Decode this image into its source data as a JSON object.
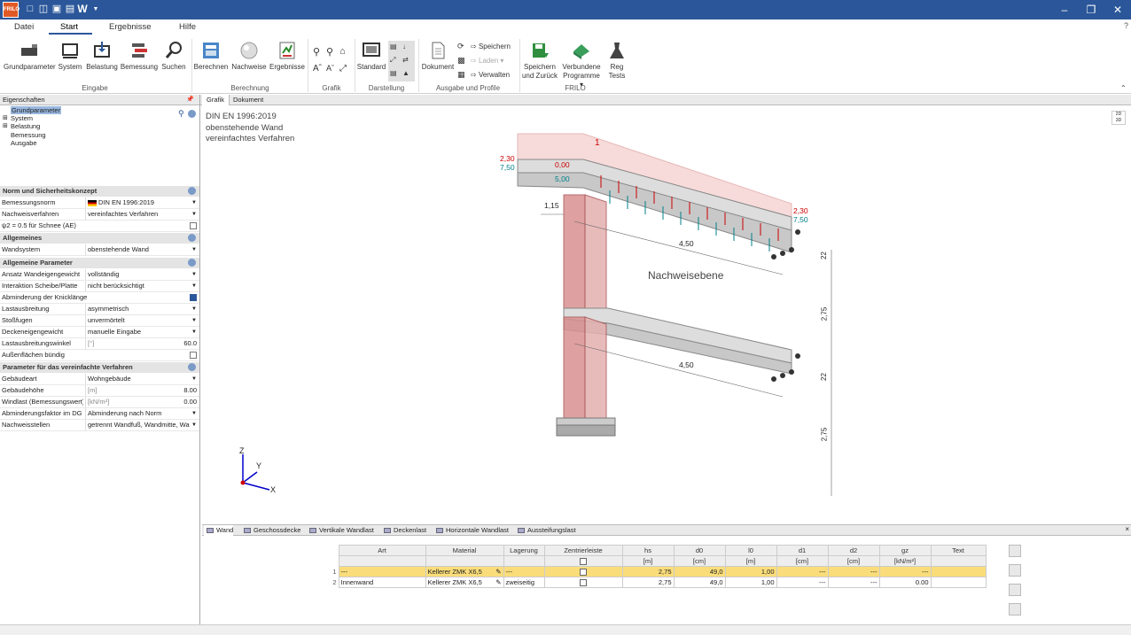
{
  "titlebar": {
    "logo": "FRILO",
    "app_letter": "W"
  },
  "menu": {
    "tabs": [
      "Datei",
      "Start",
      "Ergebnisse",
      "Hilfe"
    ],
    "active": "Start"
  },
  "ribbon": {
    "eingabe": [
      "Grundparameter",
      "System",
      "Belastung",
      "Bemessung",
      "Suchen"
    ],
    "eingabe_label": "Eingabe",
    "berechnung": [
      "Berechnen",
      "Nachweise",
      "Ergebnisse"
    ],
    "berechnung_label": "Berechnung",
    "grafik_label": "Grafik",
    "darstellung": {
      "button": "Standard",
      "label": "Darstellung"
    },
    "ausgabe": {
      "dokument": "Dokument",
      "speichern": "Speichern",
      "laden": "Laden",
      "verwalten": "Verwalten",
      "label": "Ausgabe und Profile"
    },
    "frilo": {
      "speichern_l1": "Speichern",
      "speichern_l2": "und Zurück",
      "verbundene_l1": "Verbundene",
      "verbundene_l2": "Programme",
      "reg_l1": "Reg",
      "reg_l2": "Tests",
      "label": "FRILO"
    }
  },
  "left": {
    "header": "Eigenschaften",
    "tree": [
      "Grundparameter",
      "System",
      "Belastung",
      "Bemessung",
      "Ausgabe"
    ],
    "sections": {
      "norm": "Norm und Sicherheitskonzept",
      "allgemeines": "Allgemeines",
      "allg_param": "Allgemeine Parameter",
      "vereinfacht": "Parameter für das vereinfachte Verfahren"
    },
    "rows": {
      "bemessungsnorm": {
        "label": "Bemessungsnorm",
        "value": "DIN EN 1996:2019"
      },
      "nachweisverfahren": {
        "label": "Nachweisverfahren",
        "value": "vereinfachtes Verfahren"
      },
      "psi2": {
        "label": "ψ2 = 0.5 für Schnee (AE)"
      },
      "wandsystem": {
        "label": "Wandsystem",
        "value": "obenstehende Wand"
      },
      "ansatz": {
        "label": "Ansatz Wandeigengewicht",
        "value": "vollständig"
      },
      "interaktion": {
        "label": "Interaktion Scheibe/Platte",
        "value": "nicht berücksichtigt"
      },
      "abminderung": {
        "label": "Abminderung der Knicklänge"
      },
      "lastausbreitung": {
        "label": "Lastausbreitung",
        "value": "asymmetrisch"
      },
      "stossfugen": {
        "label": "Stoßfugen",
        "value": "unvermörtelt"
      },
      "deckeneigengewicht": {
        "label": "Deckeneigengewicht",
        "value": "manuelle Eingabe"
      },
      "lastausbreitungswinkel": {
        "label": "Lastausbreitungswinkel",
        "unit": "[°]",
        "value": "60.0"
      },
      "aussenflaechen": {
        "label": "Außenflächen bündig"
      },
      "gebaeudeart": {
        "label": "Gebäudeart",
        "value": "Wohngebäude"
      },
      "gebaeudehoehe": {
        "label": "Gebäudehöhe",
        "unit": "[m]",
        "value": "8.00"
      },
      "windlast": {
        "label": "Windlast (Bemessungswert)",
        "unit": "[kN/m²]",
        "value": "0.00"
      },
      "abminderungsfaktor": {
        "label": "Abminderungsfaktor im DG",
        "value": "Abminderung nach Norm"
      },
      "nachweisstellen": {
        "label": "Nachweisstellen",
        "value": "getrennt Wandfuß, Wandmitte, Wandkopf"
      }
    }
  },
  "view": {
    "tabs": [
      "Grafik",
      "Dokument"
    ],
    "info": [
      "DIN EN 1996:2019",
      "obenstehende Wand",
      "vereinfachtes Verfahren"
    ],
    "toggle": [
      "2D",
      "3D"
    ],
    "loads": {
      "l1": "2,30",
      "l2": "7,50",
      "l3": "0,00",
      "l4": "5,00",
      "r1": "2,30",
      "r2": "7,50",
      "marker": "1"
    },
    "dims": {
      "ecc": "1,15",
      "span1": "4,50",
      "span2": "4,50",
      "h1": "2,75",
      "h2": "2,75",
      "s1": "22",
      "s2": "22"
    },
    "label": "Nachweisebene",
    "axes": {
      "x": "X",
      "y": "Y",
      "z": "Z"
    }
  },
  "bottom": {
    "tabs": [
      "Wand",
      "Geschossdecke",
      "Vertikale Wandlast",
      "Deckenlast",
      "Horizontale Wandlast",
      "Aussteifungslast"
    ],
    "close": "×",
    "headers": [
      "Art",
      "Material",
      "Lagerung",
      "Zentrierleiste",
      "hs",
      "d0",
      "l0",
      "d1",
      "d2",
      "gz",
      "Text"
    ],
    "units": [
      "",
      "",
      "",
      "",
      "[m]",
      "[cm]",
      "[m]",
      "[cm]",
      "[cm]",
      "[kN/m²]",
      ""
    ],
    "rows": [
      {
        "n": "1",
        "art": "---",
        "material": "Kellerer ZMK X6,5",
        "lagerung": "---",
        "hs": "2,75",
        "d0": "49,0",
        "l0": "1,00",
        "d1": "---",
        "d2": "---",
        "gz": "---",
        "text": ""
      },
      {
        "n": "2",
        "art": "Innenwand",
        "material": "Kellerer ZMK X6,5",
        "lagerung": "zweiseitig",
        "hs": "2,75",
        "d0": "49,0",
        "l0": "1,00",
        "d1": "---",
        "d2": "---",
        "gz": "0.00",
        "text": ""
      }
    ]
  },
  "colors": {
    "accent": "#2b579a",
    "wall": "#d99090",
    "load_red": "#c00000",
    "load_teal": "#00808a",
    "slab": "#c8c8c8"
  }
}
